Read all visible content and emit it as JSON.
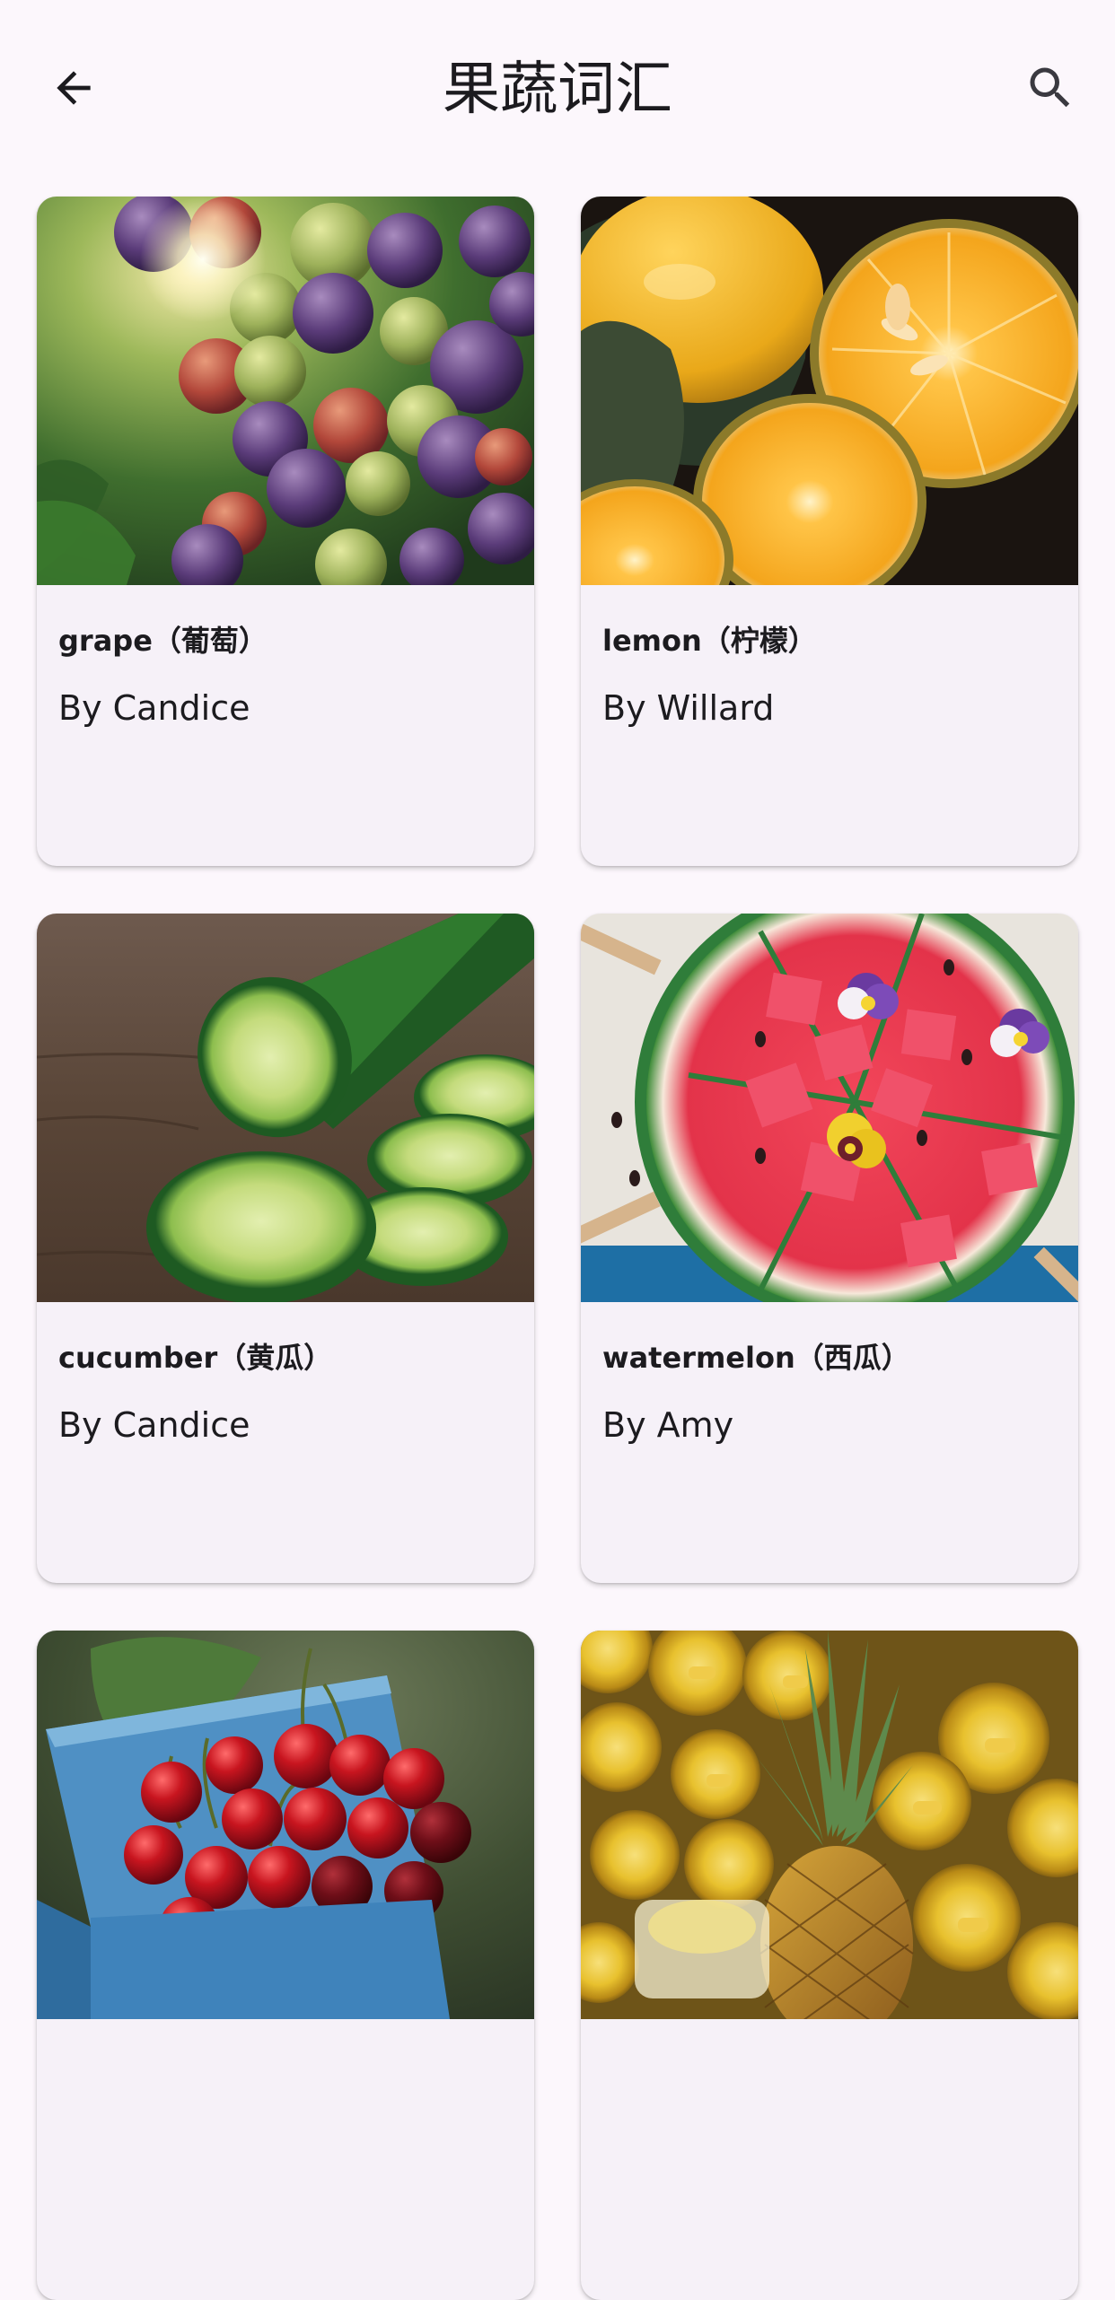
{
  "app_bar": {
    "title": "果蔬词汇",
    "back_icon": "arrow-back-icon",
    "search_icon": "search-icon"
  },
  "cards": [
    {
      "title": "grape（葡萄）",
      "author": "By Candice",
      "image": "grapes-photo"
    },
    {
      "title": "lemon（柠檬）",
      "author": "By Willard",
      "image": "lemon-photo"
    },
    {
      "title": "cucumber（黄瓜）",
      "author": "By Candice",
      "image": "cucumber-photo"
    },
    {
      "title": "watermelon（西瓜）",
      "author": "By Amy",
      "image": "watermelon-photo"
    },
    {
      "image": "cherries-photo"
    },
    {
      "image": "pineapple-photo"
    }
  ],
  "colors": {
    "background": "#FCF7FC",
    "card": "#F6F1F8",
    "text": "#1C1B1F"
  }
}
